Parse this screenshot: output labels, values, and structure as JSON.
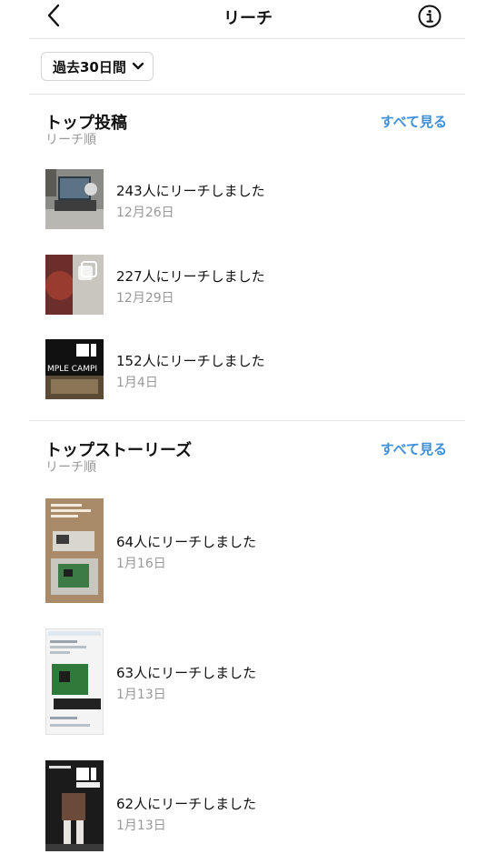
{
  "header": {
    "title": "リーチ"
  },
  "period": {
    "label": "過去30日間"
  },
  "top_posts": {
    "title": "トップ投稿",
    "subtitle": "リーチ順",
    "see_all": "すべて見る",
    "items": [
      {
        "reach": "243人にリーチしました",
        "date": "12月26日"
      },
      {
        "reach": "227人にリーチしました",
        "date": "12月29日"
      },
      {
        "reach": "152人にリーチしました",
        "date": "1月4日",
        "thumb_text": "MPLE CAMPI"
      }
    ]
  },
  "top_stories": {
    "title": "トップストーリーズ",
    "subtitle": "リーチ順",
    "see_all": "すべて見る",
    "items": [
      {
        "reach": "64人にリーチしました",
        "date": "1月16日"
      },
      {
        "reach": "63人にリーチしました",
        "date": "1月13日"
      },
      {
        "reach": "62人にリーチしました",
        "date": "1月13日"
      }
    ]
  },
  "colors": {
    "accent": "#3f8fd9",
    "secondary_text": "#999999",
    "divider": "#e3e3e3"
  }
}
